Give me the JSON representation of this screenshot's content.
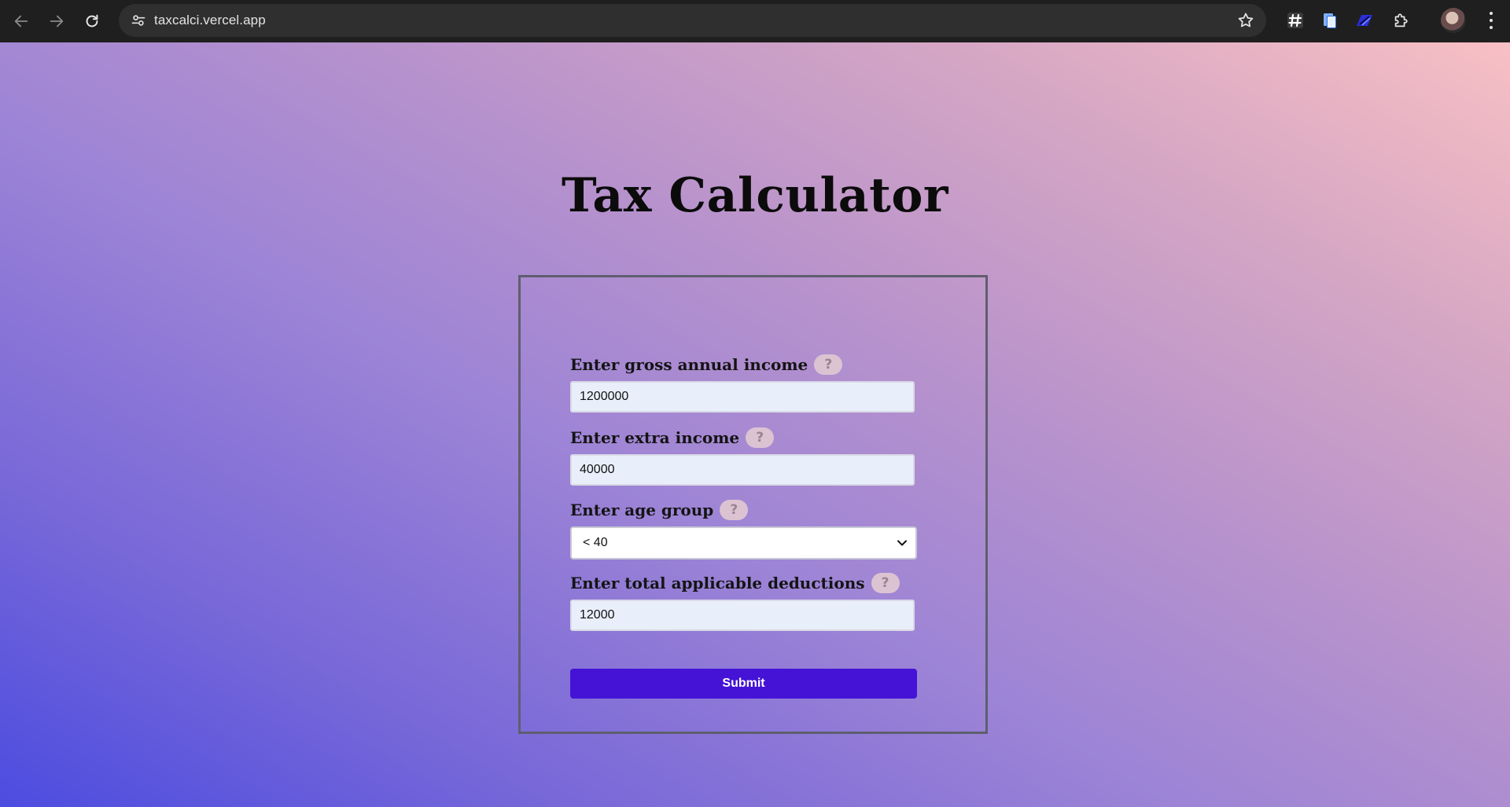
{
  "browser": {
    "url": "taxcalci.vercel.app"
  },
  "page": {
    "title": "Tax Calculator"
  },
  "form": {
    "gross_income": {
      "label": "Enter gross annual income",
      "help": "?",
      "value": "1200000"
    },
    "extra_income": {
      "label": "Enter extra income",
      "help": "?",
      "value": "40000"
    },
    "age_group": {
      "label": "Enter age group",
      "help": "?",
      "selected": "< 40"
    },
    "deductions": {
      "label": "Enter total applicable deductions",
      "help": "?",
      "value": "12000"
    },
    "submit_label": "Submit"
  },
  "colors": {
    "accent": "#4413d6",
    "help_badge": "#dcc3d2",
    "input_bg": "#e8effb"
  },
  "icons": {
    "back": "arrow-left-icon",
    "forward": "arrow-right-icon",
    "reload": "reload-icon",
    "site_info": "tune-icon",
    "bookmark": "star-icon",
    "extensions": [
      "hashtag-extension-icon",
      "document-extension-icon",
      "pen-extension-icon",
      "puzzle-icon"
    ],
    "menu": "more-vert-icon",
    "dropdown": "chevron-down-icon"
  }
}
